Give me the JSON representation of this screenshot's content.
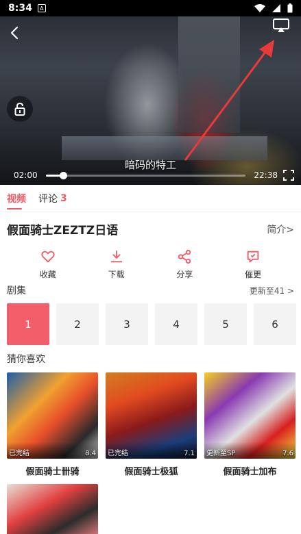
{
  "status_bar": {
    "time": "8:34",
    "notification_glyph": "A"
  },
  "player": {
    "subtitle": "暗码的特工",
    "current_time": "02:00",
    "total_time": "22:38",
    "progress_fraction": 0.088
  },
  "tabs": [
    {
      "label": "视频",
      "count": ""
    },
    {
      "label": "评论",
      "count": "3"
    }
  ],
  "show": {
    "title": "假面骑士ZEZTZ日语",
    "intro_link": "简介>"
  },
  "actions": [
    {
      "label": "收藏",
      "icon": "heart-icon"
    },
    {
      "label": "下载",
      "icon": "download-icon"
    },
    {
      "label": "分享",
      "icon": "share-icon"
    },
    {
      "label": "催更",
      "icon": "remind-icon"
    }
  ],
  "episodes_section": {
    "title": "剧集",
    "more": "更新至41 >",
    "items": [
      "1",
      "2",
      "3",
      "4",
      "5",
      "6"
    ],
    "active_index": 0
  },
  "recommend_section": {
    "title": "猜你喜欢",
    "items": [
      {
        "name": "假面骑士卌骑",
        "status": "已完结",
        "score": "8.4"
      },
      {
        "name": "假面骑士极狐",
        "status": "已完结",
        "score": "7.1"
      },
      {
        "name": "假面骑士加布",
        "status": "更新至SP",
        "score": "7.6"
      },
      {
        "name": "",
        "status": "",
        "score": ""
      }
    ]
  },
  "colors": {
    "accent": "#f05a64",
    "episode_active": "#f25e6a",
    "statusbar_bg": "#000000"
  }
}
